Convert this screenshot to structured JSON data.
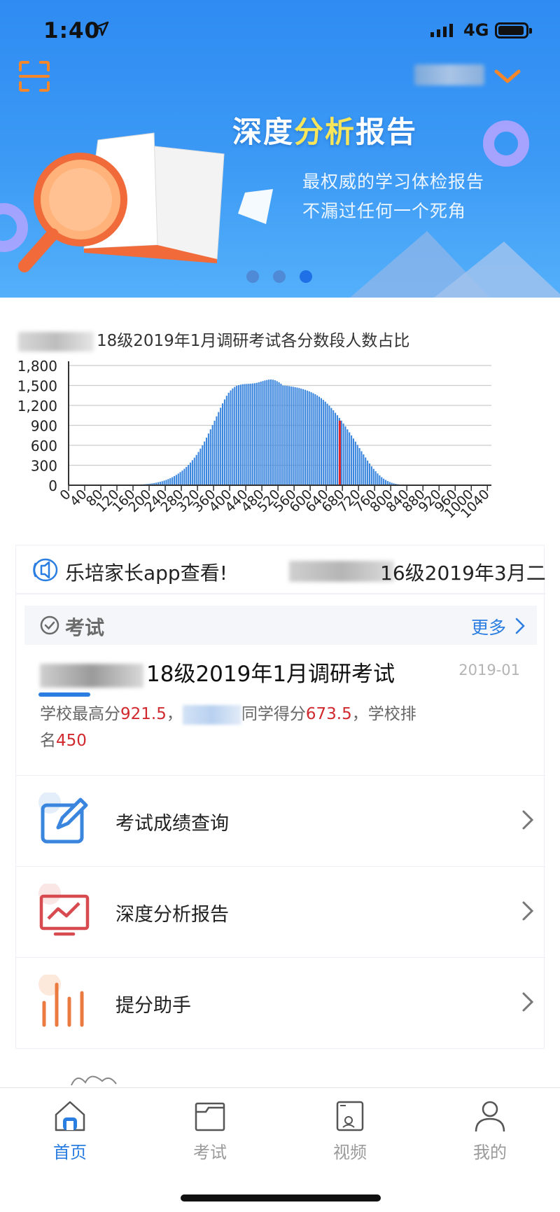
{
  "status_bar": {
    "time": "1:40",
    "network": "4G"
  },
  "banner": {
    "title_part1": "深度",
    "title_highlight": "分析",
    "title_part2": "报告",
    "subtitle_line1": "最权威的学习体检报告",
    "subtitle_line2": "不漏过任何一个死角",
    "page_count": 3,
    "active_page": 3
  },
  "chart_data": {
    "type": "bar",
    "title": "18级2019年1月调研考试各分数段人数占比",
    "ylim": [
      0,
      1800
    ],
    "yticks": [
      "0",
      "300",
      "600",
      "900",
      "1,200",
      "1,500",
      "1,800"
    ],
    "xticks": [
      "0",
      "40",
      "80",
      "120",
      "160",
      "200",
      "240",
      "280",
      "320",
      "360",
      "400",
      "440",
      "480",
      "520",
      "560",
      "600",
      "640",
      "680",
      "720",
      "760",
      "800",
      "840",
      "880",
      "920",
      "960",
      "1000",
      "1040"
    ],
    "bin_width": 5,
    "highlight_x": 673.5,
    "colors": {
      "bar": "#3a86de",
      "highlight": "#e0262b",
      "grid": "#cccccc",
      "axis": "#333333"
    },
    "x": [
      0,
      5,
      10,
      15,
      20,
      25,
      30,
      35,
      40,
      45,
      50,
      55,
      60,
      65,
      70,
      75,
      80,
      85,
      90,
      95,
      100,
      105,
      110,
      115,
      120,
      125,
      130,
      135,
      140,
      145,
      150,
      155,
      160,
      165,
      170,
      175,
      180,
      185,
      190,
      195,
      200,
      205,
      210,
      215,
      220,
      225,
      230,
      235,
      240,
      245,
      250,
      255,
      260,
      265,
      270,
      275,
      280,
      285,
      290,
      295,
      300,
      305,
      310,
      315,
      320,
      325,
      330,
      335,
      340,
      345,
      350,
      355,
      360,
      365,
      370,
      375,
      380,
      385,
      390,
      395,
      400,
      405,
      410,
      415,
      420,
      425,
      430,
      435,
      440,
      445,
      450,
      455,
      460,
      465,
      470,
      475,
      480,
      485,
      490,
      495,
      500,
      505,
      510,
      515,
      520,
      525,
      530,
      535,
      540,
      545,
      550,
      555,
      560,
      565,
      570,
      575,
      580,
      585,
      590,
      595,
      600,
      605,
      610,
      615,
      620,
      625,
      630,
      635,
      640,
      645,
      650,
      655,
      660,
      665,
      670,
      675,
      680,
      685,
      690,
      695,
      700,
      705,
      710,
      715,
      720,
      725,
      730,
      735,
      740,
      745,
      750,
      755,
      760,
      765,
      770,
      775,
      780,
      785,
      790,
      795,
      800,
      805,
      810,
      815,
      820,
      825,
      830,
      835,
      840,
      845,
      850,
      855,
      860,
      865,
      870,
      875,
      880,
      885,
      890,
      895,
      900,
      905,
      910,
      915,
      920,
      925,
      930,
      935,
      940,
      945,
      950,
      955,
      960,
      965,
      970,
      975,
      980,
      985,
      990,
      995,
      1000,
      1005,
      1010,
      1015,
      1020,
      1025,
      1030,
      1035,
      1040
    ],
    "values": [
      0,
      0,
      0,
      0,
      0,
      0,
      0,
      0,
      0,
      0,
      0,
      0,
      0,
      0,
      0,
      0,
      0,
      0,
      0,
      0,
      0,
      0,
      0,
      0,
      3,
      3,
      4,
      4,
      5,
      5,
      6,
      6,
      7,
      8,
      9,
      10,
      12,
      14,
      17,
      20,
      24,
      28,
      33,
      38,
      45,
      52,
      60,
      70,
      80,
      92,
      106,
      120,
      137,
      155,
      175,
      197,
      220,
      247,
      275,
      306,
      340,
      376,
      414,
      455,
      500,
      550,
      600,
      657,
      715,
      777,
      840,
      905,
      970,
      1035,
      1100,
      1165,
      1230,
      1290,
      1345,
      1390,
      1425,
      1455,
      1478,
      1495,
      1505,
      1512,
      1518,
      1521,
      1523,
      1525,
      1527,
      1530,
      1534,
      1540,
      1548,
      1557,
      1566,
      1575,
      1582,
      1588,
      1590,
      1586,
      1578,
      1565,
      1548,
      1525,
      1500,
      1497,
      1494,
      1490,
      1485,
      1480,
      1474,
      1468,
      1461,
      1453,
      1444,
      1434,
      1423,
      1411,
      1398,
      1384,
      1368,
      1350,
      1330,
      1308,
      1283,
      1256,
      1226,
      1195,
      1161,
      1126,
      1089,
      1051,
      1012,
      971,
      928,
      884,
      840,
      795,
      749,
      702,
      655,
      607,
      559,
      511,
      464,
      417,
      371,
      327,
      285,
      246,
      210,
      177,
      147,
      121,
      98,
      79,
      63,
      49,
      37,
      28,
      21,
      15,
      10,
      7,
      5,
      3,
      2,
      1,
      1,
      0,
      0,
      0,
      0,
      0,
      0,
      0,
      0,
      0,
      0,
      0,
      0,
      0,
      0,
      0,
      0,
      0,
      0,
      0,
      0,
      0,
      0,
      0,
      0,
      0,
      0,
      0,
      0,
      0,
      0,
      0,
      0,
      0,
      0,
      0,
      0,
      0,
      0,
      0,
      0,
      0,
      0,
      0,
      0,
      0
    ]
  },
  "marquee": {
    "text1": "乐培家长app查看!",
    "text2": "16级2019年3月二"
  },
  "exam": {
    "section_label": "考试",
    "more_label": "更多",
    "name": "18级2019年1月调研考试",
    "date": "2019-01",
    "info_prefix": "学校最高分",
    "school_max": "921.5",
    "info_sep": "，",
    "info_mid": "同学得分",
    "student_score": "673.5",
    "info_rank_label": "，学校排名",
    "rank": "450"
  },
  "menu": [
    {
      "label": "考试成绩查询",
      "icon": "edit-icon"
    },
    {
      "label": "深度分析报告",
      "icon": "chart-board-icon"
    },
    {
      "label": "提分助手",
      "icon": "bars-icon"
    }
  ],
  "tabs": [
    {
      "label": "首页",
      "icon": "home-icon",
      "active": true
    },
    {
      "label": "考试",
      "icon": "folder-icon",
      "active": false
    },
    {
      "label": "视频",
      "icon": "video-icon",
      "active": false
    },
    {
      "label": "我的",
      "icon": "person-icon",
      "active": false
    }
  ]
}
